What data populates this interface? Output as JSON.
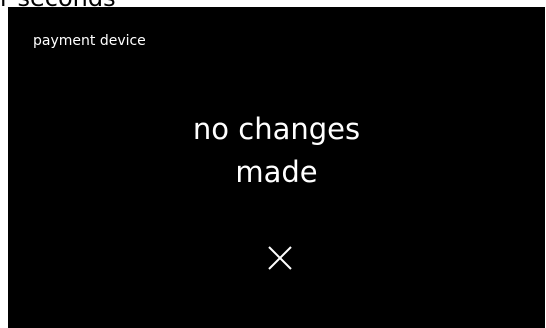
{
  "caption": {
    "text": "r seconds"
  },
  "screen": {
    "title": "payment device",
    "message_line1": "no changes",
    "message_line2": "made"
  },
  "icons": {
    "close": "close-icon"
  },
  "colors": {
    "screen_background": "#000000",
    "text": "#ffffff"
  }
}
